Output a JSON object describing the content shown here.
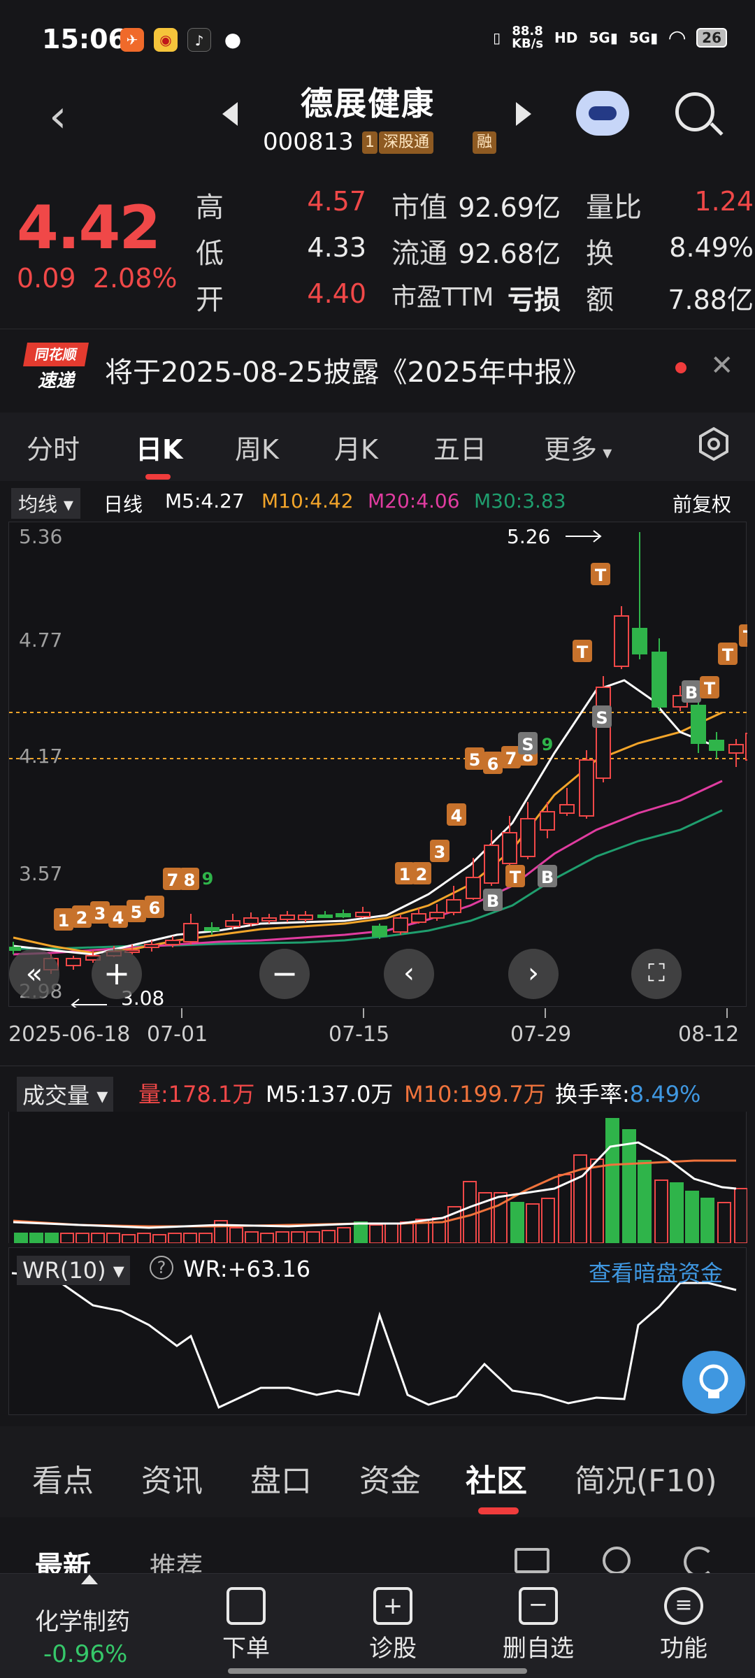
{
  "status_bar": {
    "time": "15:06",
    "net_speed_value": "88.8",
    "net_speed_unit": "KB/s",
    "battery": "26"
  },
  "header": {
    "stock_name": "德展健康",
    "stock_code": "000813",
    "tags": [
      "1",
      "深股通",
      "融"
    ]
  },
  "quote": {
    "price": "4.42",
    "change": "0.09",
    "change_pct": "2.08%",
    "high_label": "高",
    "high": "4.57",
    "low_label": "低",
    "low": "4.33",
    "open_label": "开",
    "open": "4.40",
    "mcap_label": "市值",
    "mcap": "92.69亿",
    "float_label": "流通",
    "float": "92.68亿",
    "pe_label": "市盈TTM",
    "pe": "亏损",
    "vr_label": "量比",
    "vr": "1.24",
    "turnover_label": "换",
    "turnover": "8.49%",
    "amount_label": "额",
    "amount": "7.88亿"
  },
  "news": {
    "logo_top": "同花顺",
    "logo_bottom": "速递",
    "text": "将于2025-08-25披露《2025年中报》"
  },
  "tabs": [
    "分时",
    "日K",
    "周K",
    "月K",
    "五日",
    "更多"
  ],
  "ma_legend": {
    "selector": "均线",
    "period": "日线",
    "m5": "M5:4.27",
    "m10": "M10:4.42",
    "m20": "M20:4.06",
    "m30": "M30:3.83",
    "adjust": "前复权",
    "colors": {
      "m5": "#ffffff",
      "m10": "#f3a52a",
      "m20": "#e03ca0",
      "m30": "#1f9e6e"
    }
  },
  "kline": {
    "y_labels": [
      "5.36",
      "4.77",
      "4.17",
      "3.57",
      "2.98"
    ],
    "max_label": "5.26",
    "min_label": "3.08",
    "x_labels": [
      "2025-06-18",
      "07-01",
      "07-15",
      "07-29",
      "08-12"
    ],
    "marker_letters": [
      "T",
      "B",
      "S"
    ],
    "marker_numbers": [
      "1",
      "2",
      "3",
      "4",
      "5",
      "6",
      "7",
      "8",
      "9"
    ]
  },
  "volume": {
    "selector": "成交量",
    "vol": "量:178.1万",
    "m5": "M5:137.0万",
    "m10": "M10:199.7万",
    "turnover_label": "换手率:",
    "turnover_value": "8.49%"
  },
  "wr": {
    "selector": "WR(10)",
    "value": "WR:+63.16",
    "link": "查看暗盘资金"
  },
  "bottom_tabs": [
    "看点",
    "资讯",
    "盘口",
    "资金",
    "社区",
    "简况(F10)"
  ],
  "sub_tabs": [
    "最新",
    "推荐"
  ],
  "footer": {
    "sector_name": "化学制药",
    "sector_change": "-0.96%",
    "items": [
      "下单",
      "诊股",
      "删自选",
      "功能"
    ]
  }
}
